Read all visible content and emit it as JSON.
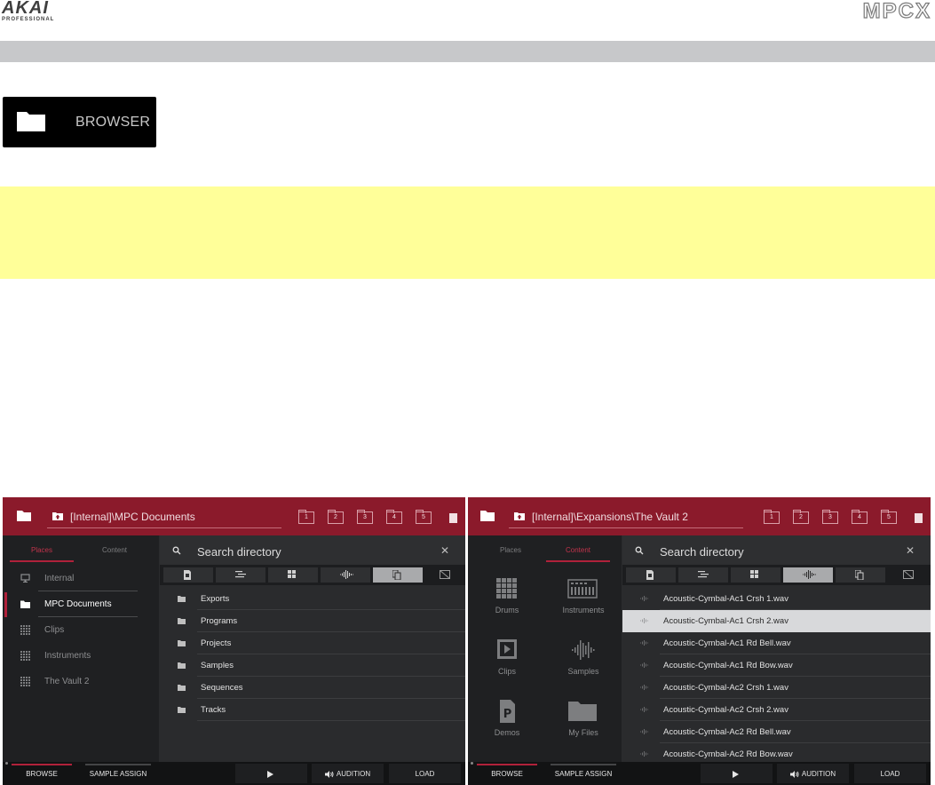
{
  "header": {
    "brand": "AKAI",
    "brand_sub": "PROFESSIONAL",
    "product": "MPCX"
  },
  "browser_button": {
    "label": "BROWSER",
    "icon": "folder-icon"
  },
  "screens": [
    {
      "path": "[Internal]\\MPC Documents",
      "locations": [
        "1",
        "2",
        "3",
        "4",
        "5"
      ],
      "tabs": {
        "places": "Places",
        "content": "Content",
        "active": "places"
      },
      "places": [
        {
          "label": "Internal",
          "icon": "monitor-icon"
        },
        {
          "label": "MPC Documents",
          "icon": "folder-icon",
          "selected": true
        },
        {
          "label": "Clips",
          "icon": "grid-icon"
        },
        {
          "label": "Instruments",
          "icon": "grid-icon"
        },
        {
          "label": "The Vault 2",
          "icon": "grid-icon"
        }
      ],
      "search_placeholder": "Search directory",
      "active_filter": 4,
      "items": [
        "Exports",
        "Programs",
        "Projects",
        "Samples",
        "Sequences",
        "Tracks"
      ],
      "bottom": {
        "browse": "BROWSE",
        "sample_assign": "SAMPLE ASSIGN",
        "audition": "AUDITION",
        "load": "LOAD"
      }
    },
    {
      "path": "[Internal]\\Expansions\\The Vault 2",
      "locations": [
        "1",
        "2",
        "3",
        "4",
        "5"
      ],
      "tabs": {
        "places": "Places",
        "content": "Content",
        "active": "content"
      },
      "content_categories": [
        {
          "label": "Drums",
          "icon": "drums-grid-icon"
        },
        {
          "label": "Instruments",
          "icon": "keyboard-icon"
        },
        {
          "label": "Clips",
          "icon": "clip-play-icon"
        },
        {
          "label": "Samples",
          "icon": "waveform-icon"
        },
        {
          "label": "Demos",
          "icon": "demo-p-icon"
        },
        {
          "label": "My Files",
          "icon": "folder-icon"
        }
      ],
      "search_placeholder": "Search directory",
      "active_filter": 3,
      "items": [
        "Acoustic-Cymbal-Ac1 Crsh 1.wav",
        "Acoustic-Cymbal-Ac1 Crsh 2.wav",
        "Acoustic-Cymbal-Ac1 Rd Bell.wav",
        "Acoustic-Cymbal-Ac1 Rd Bow.wav",
        "Acoustic-Cymbal-Ac2 Crsh 1.wav",
        "Acoustic-Cymbal-Ac2 Crsh 2.wav",
        "Acoustic-Cymbal-Ac2 Rd Bell.wav",
        "Acoustic-Cymbal-Ac2 Rd Bow.wav"
      ],
      "selected_item": 1,
      "bottom": {
        "browse": "BROWSE",
        "sample_assign": "SAMPLE ASSIGN",
        "audition": "AUDITION",
        "load": "LOAD"
      }
    }
  ],
  "colors": {
    "accent": "#8b1a2b",
    "selection": "#b0213a",
    "note": "#ffff99"
  }
}
